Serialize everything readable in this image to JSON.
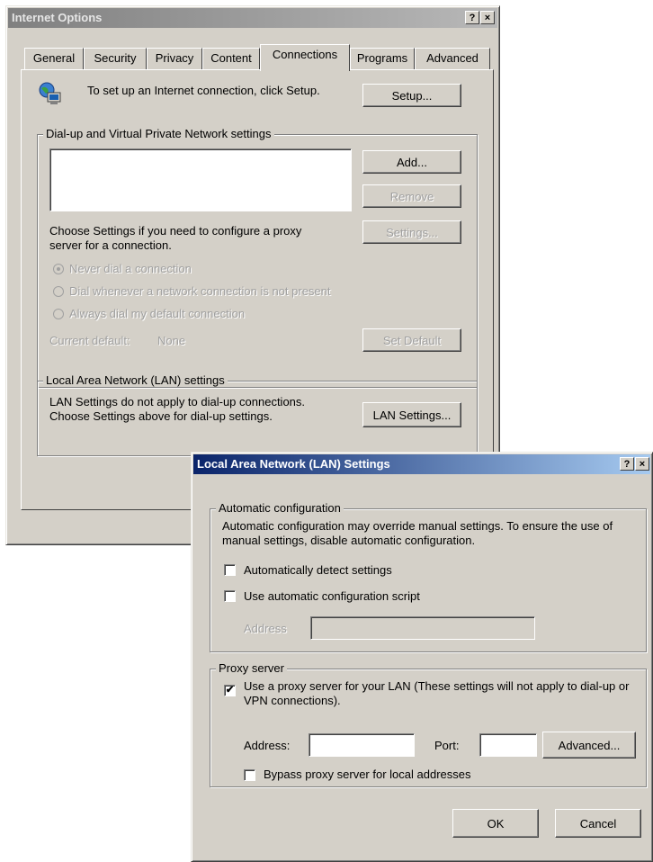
{
  "internet_options": {
    "title": "Internet Options",
    "help_btn": "?",
    "close_btn": "×",
    "tabs": [
      "General",
      "Security",
      "Privacy",
      "Content",
      "Connections",
      "Programs",
      "Advanced"
    ],
    "active_tab": "Connections",
    "setup_text": "To set up an Internet connection, click Setup.",
    "setup_button": "Setup...",
    "dialup_group": "Dial-up and Virtual Private Network settings",
    "add_button": "Add...",
    "remove_button": "Remove",
    "settings_text": "Choose Settings if you need to configure a proxy server for a connection.",
    "settings_button": "Settings...",
    "radios": [
      "Never dial a connection",
      "Dial whenever a network connection is not present",
      "Always dial my default connection"
    ],
    "current_default_label": "Current default:",
    "current_default_value": "None",
    "set_default_button": "Set Default",
    "lan_group": "Local Area Network (LAN) settings",
    "lan_text": "LAN Settings do not apply to dial-up connections. Choose Settings above for dial-up settings.",
    "lan_settings_button": "LAN Settings..."
  },
  "lan_dialog": {
    "title": "Local Area Network (LAN) Settings",
    "help_btn": "?",
    "close_btn": "×",
    "auto_group": "Automatic configuration",
    "auto_text": "Automatic configuration may override manual settings.  To ensure the use of manual settings, disable automatic configuration.",
    "auto_detect_label": "Automatically detect settings",
    "auto_detect_checked": false,
    "auto_script_label": "Use automatic configuration script",
    "auto_script_checked": false,
    "address_label": "Address",
    "address_value": "",
    "proxy_group": "Proxy server",
    "use_proxy_label": "Use a proxy server for your LAN (These settings will not apply to dial-up or VPN connections).",
    "use_proxy_checked": true,
    "proxy_address_label": "Address:",
    "proxy_address_value": "",
    "port_label": "Port:",
    "port_value": "",
    "advanced_button": "Advanced...",
    "bypass_label": "Bypass proxy server for local addresses",
    "bypass_checked": false,
    "ok_button": "OK",
    "cancel_button": "Cancel"
  }
}
